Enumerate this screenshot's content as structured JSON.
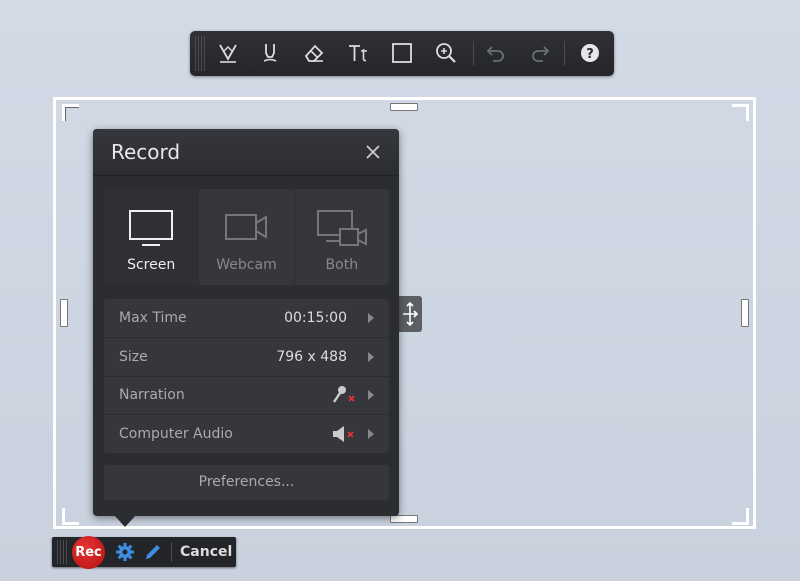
{
  "toolbar": {
    "tools": [
      {
        "name": "pen-icon"
      },
      {
        "name": "highlighter-icon"
      },
      {
        "name": "eraser-icon"
      },
      {
        "name": "text-icon"
      },
      {
        "name": "rectangle-icon"
      },
      {
        "name": "zoom-in-icon"
      },
      {
        "name": "undo-icon"
      },
      {
        "name": "redo-icon"
      },
      {
        "name": "help-icon"
      }
    ]
  },
  "panel": {
    "title": "Record",
    "modes": [
      {
        "label": "Screen",
        "icon": "monitor-icon",
        "selected": true
      },
      {
        "label": "Webcam",
        "icon": "webcam-icon",
        "selected": false
      },
      {
        "label": "Both",
        "icon": "screen-webcam-icon",
        "selected": false
      }
    ],
    "settings": [
      {
        "label": "Max Time",
        "value": "00:15:00"
      },
      {
        "label": "Size",
        "value": "796 x 488"
      },
      {
        "label": "Narration",
        "value": "",
        "icon": "microphone-muted-icon"
      },
      {
        "label": "Computer Audio",
        "value": "",
        "icon": "speaker-muted-icon"
      }
    ],
    "preferences_label": "Preferences..."
  },
  "recbar": {
    "rec_label": "Rec",
    "cancel_label": "Cancel"
  },
  "colors": {
    "panel_bg": "#2b2d31",
    "rec_red": "#d21f1f",
    "accent_blue": "#3d8fe0",
    "mute_red": "#e53030"
  }
}
